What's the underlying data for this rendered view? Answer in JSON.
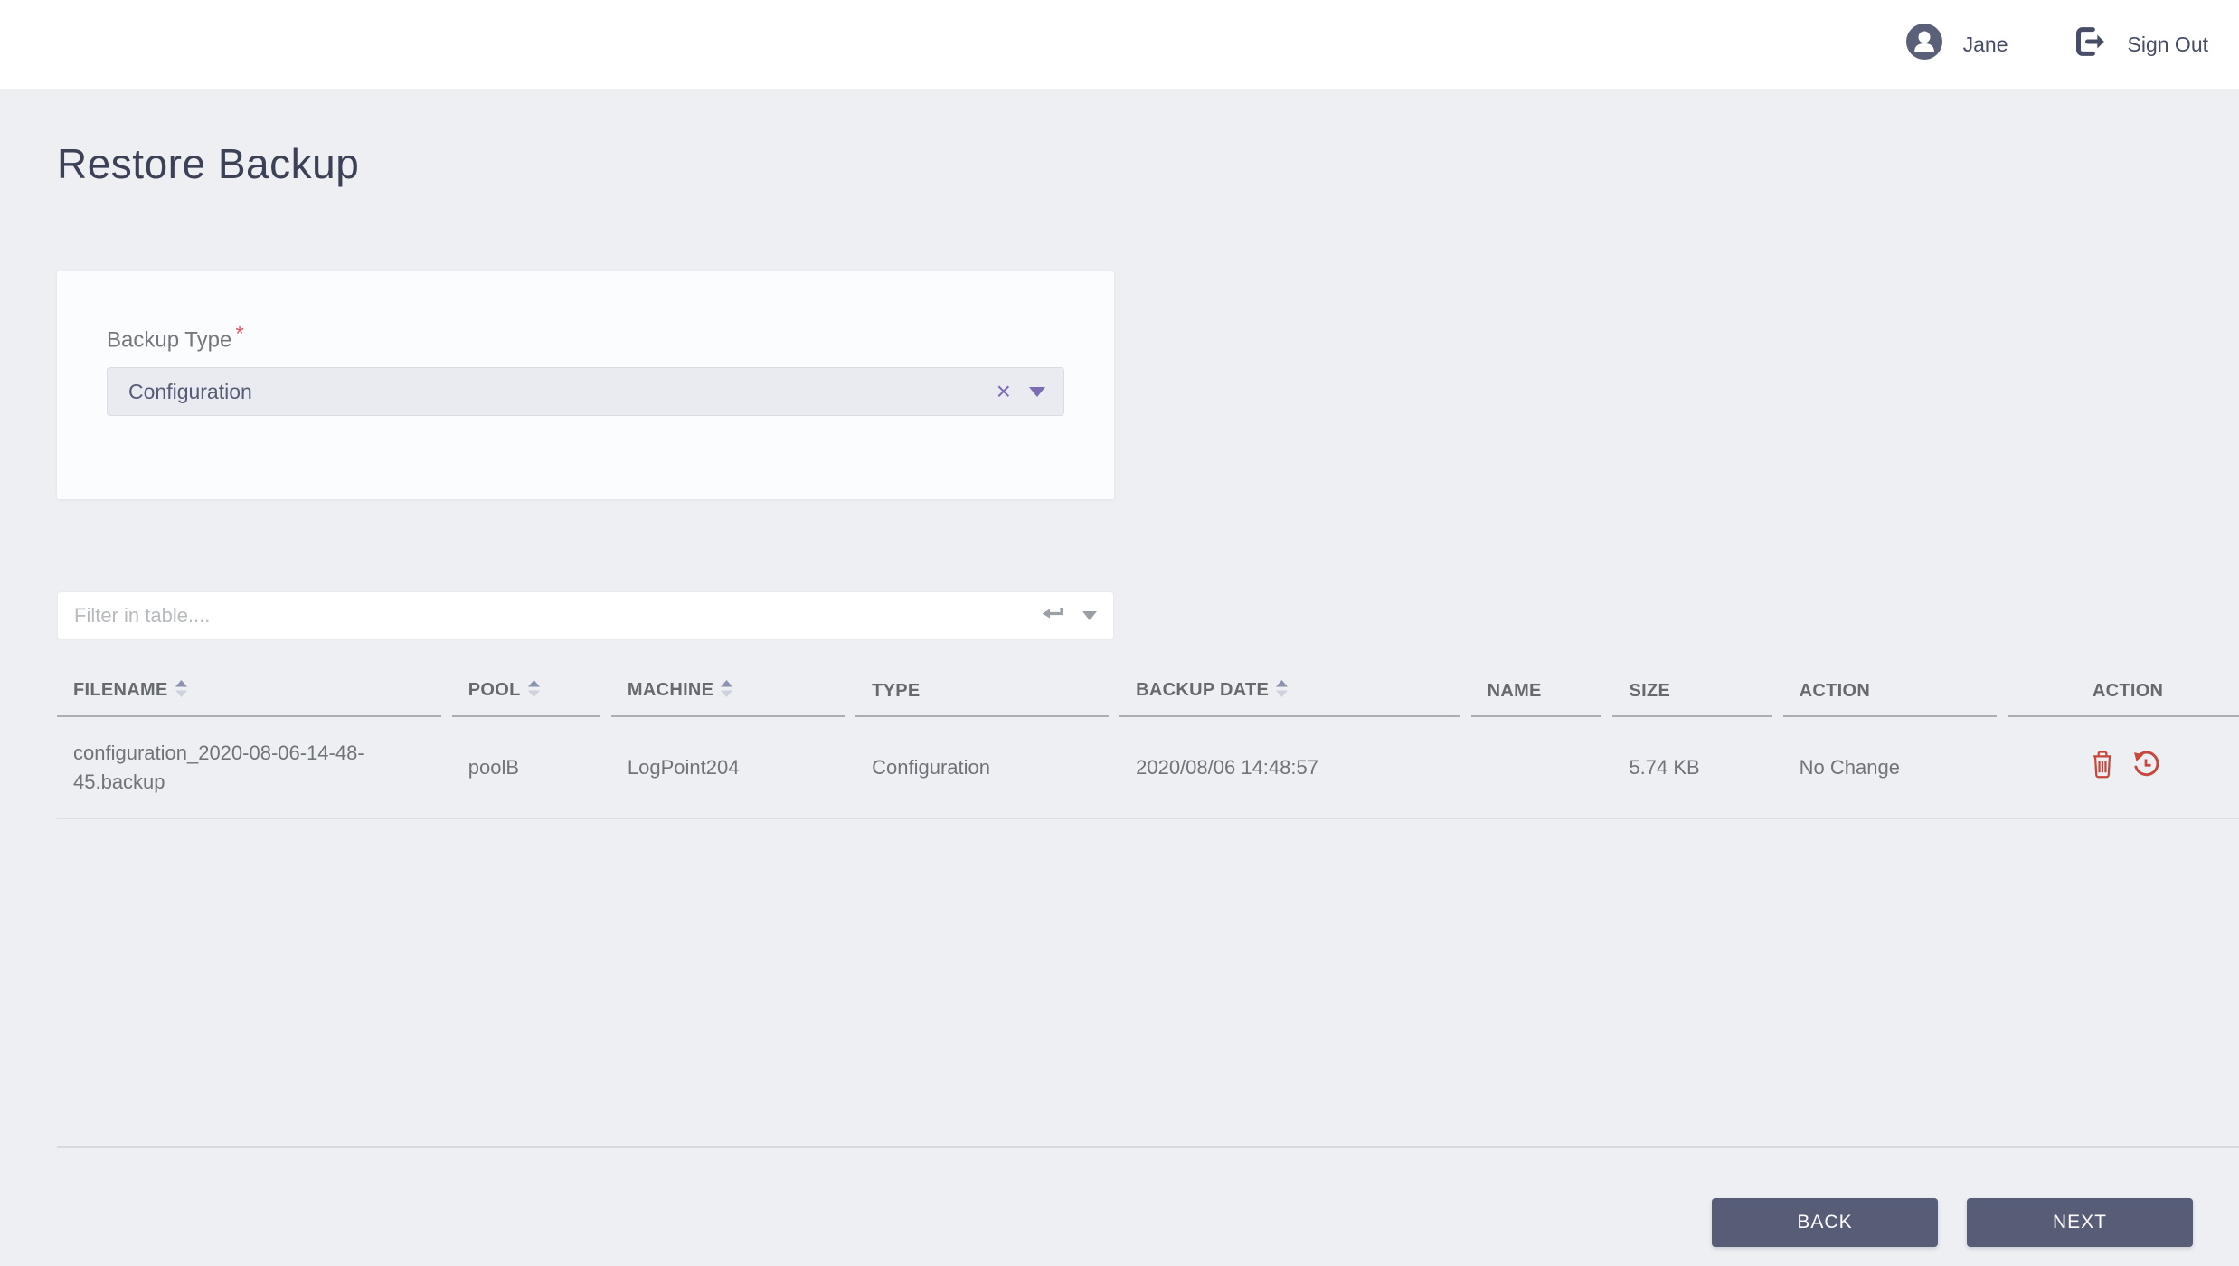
{
  "header": {
    "user_name": "Jane",
    "sign_out_label": "Sign Out"
  },
  "page": {
    "title": "Restore Backup"
  },
  "form": {
    "backup_type": {
      "label": "Backup Type",
      "required_marker": "*",
      "selected_value": "Configuration",
      "clear_glyph": "×"
    }
  },
  "filter": {
    "placeholder": "Filter in table...."
  },
  "table": {
    "columns": [
      {
        "label": "FILENAME",
        "sortable": true
      },
      {
        "label": "POOL",
        "sortable": true
      },
      {
        "label": "MACHINE",
        "sortable": true
      },
      {
        "label": "TYPE",
        "sortable": false
      },
      {
        "label": "BACKUP DATE",
        "sortable": true
      },
      {
        "label": "NAME",
        "sortable": false
      },
      {
        "label": "SIZE",
        "sortable": false
      },
      {
        "label": "ACTION",
        "sortable": false
      },
      {
        "label": "ACTION",
        "sortable": false
      }
    ],
    "rows": [
      {
        "filename": "configuration_2020-08-06-14-48-45.backup",
        "pool": "poolB",
        "machine": "LogPoint204",
        "type": "Configuration",
        "backup_date": "2020/08/06 14:48:57",
        "name": "",
        "size": "5.74 KB",
        "action": "No Change",
        "row_icons": [
          "delete-icon",
          "restore-icon"
        ]
      }
    ]
  },
  "footer": {
    "back_label": "BACK",
    "next_label": "NEXT"
  },
  "colors": {
    "accent_purple": "#7c6cb4",
    "danger_red": "#c9463d",
    "button_slate": "#575c77",
    "header_text": "#66696e",
    "title_text": "#3c4156",
    "page_background": "#edeff3"
  }
}
